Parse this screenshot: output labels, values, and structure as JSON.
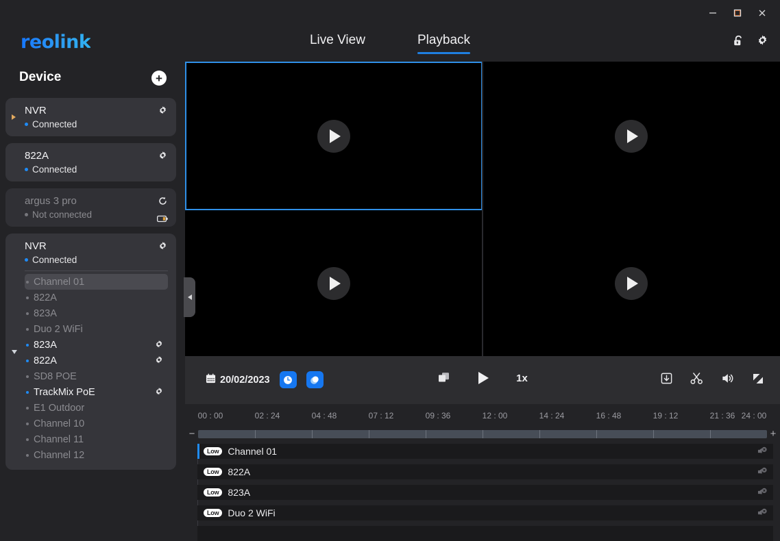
{
  "window": {
    "minimize": "minimize-icon",
    "maximize": "maximize-icon",
    "close": "close-icon"
  },
  "header": {
    "logo": "reolink",
    "tabs": [
      {
        "label": "Live View",
        "active": false
      },
      {
        "label": "Playback",
        "active": true
      }
    ],
    "icons": [
      {
        "name": "unlock-icon"
      },
      {
        "name": "gear-icon"
      }
    ],
    "accent_color": "#1f7fe0"
  },
  "sidebar": {
    "title": "Device",
    "add_label": "+",
    "devices": [
      {
        "name": "NVR",
        "status": "Connected",
        "connected": true,
        "expanded": false,
        "has_gear": true,
        "has_battery": false
      },
      {
        "name": "822A",
        "status": "Connected",
        "connected": true,
        "expanded": null,
        "has_gear": true,
        "has_battery": false
      },
      {
        "name": "argus 3 pro",
        "status": "Not connected",
        "connected": false,
        "expanded": null,
        "has_gear": false,
        "has_refresh": true,
        "has_battery": true
      },
      {
        "name": "NVR",
        "status": "Connected",
        "connected": true,
        "expanded": true,
        "has_gear": true,
        "has_battery": false,
        "channels": [
          {
            "label": "Channel 01",
            "online": false,
            "selected": true,
            "gear": false
          },
          {
            "label": "822A",
            "online": false,
            "selected": false,
            "gear": false
          },
          {
            "label": "823A",
            "online": false,
            "selected": false,
            "gear": false
          },
          {
            "label": "Duo 2 WiFi",
            "online": false,
            "selected": false,
            "gear": false
          },
          {
            "label": "823A",
            "online": true,
            "selected": false,
            "gear": true
          },
          {
            "label": "822A",
            "online": true,
            "selected": false,
            "gear": true
          },
          {
            "label": "SD8 POE",
            "online": false,
            "selected": false,
            "gear": false
          },
          {
            "label": "TrackMix PoE",
            "online": true,
            "selected": false,
            "gear": true
          },
          {
            "label": "E1 Outdoor",
            "online": false,
            "selected": false,
            "gear": false
          },
          {
            "label": "Channel 10",
            "online": false,
            "selected": false,
            "gear": false
          },
          {
            "label": "Channel 11",
            "online": false,
            "selected": false,
            "gear": false
          },
          {
            "label": "Channel 12",
            "online": false,
            "selected": false,
            "gear": false
          }
        ]
      }
    ]
  },
  "grid": {
    "cells": [
      {
        "id": "cell-1",
        "active": true,
        "play": "play-icon"
      },
      {
        "id": "cell-2",
        "active": false,
        "play": "play-icon"
      },
      {
        "id": "cell-3",
        "active": false,
        "play": "play-icon"
      },
      {
        "id": "cell-4",
        "active": false,
        "play": "play-icon"
      }
    ],
    "selection_color": "#2f90e8",
    "collapse_handle": "collapse-sidebar-handle"
  },
  "controls": {
    "date": "20/02/2023",
    "calendar_icon": "calendar-icon",
    "filter_buttons": [
      {
        "name": "clock-filter-icon"
      },
      {
        "name": "motion-filter-icon"
      }
    ],
    "layout_icon": "layout-icon",
    "play_icon": "play-icon",
    "speed": "1x",
    "right_icons": [
      {
        "name": "download-icon"
      },
      {
        "name": "scissors-icon"
      },
      {
        "name": "volume-icon"
      },
      {
        "name": "fullscreen-icon"
      }
    ],
    "blue_button_color": "#1677f0"
  },
  "timeline": {
    "ticks": [
      "00 : 00",
      "02 : 24",
      "04 : 48",
      "07 : 12",
      "09 : 36",
      "12 : 00",
      "14 : 24",
      "16 : 48",
      "19 : 12",
      "21 : 36",
      "24 : 00"
    ],
    "zoom_out": "−",
    "zoom_in": "+",
    "playhead_color": "#1f8bf5",
    "rows": [
      {
        "quality": "Low",
        "label": "Channel 01",
        "mute": "muted-speaker-icon",
        "playhead": true
      },
      {
        "quality": "Low",
        "label": "822A",
        "mute": "muted-speaker-icon",
        "playhead": false
      },
      {
        "quality": "Low",
        "label": "823A",
        "mute": "muted-speaker-icon",
        "playhead": false
      },
      {
        "quality": "Low",
        "label": "Duo 2 WiFi",
        "mute": "muted-speaker-icon",
        "playhead": false
      },
      {
        "quality": "",
        "label": "",
        "mute": "",
        "playhead": false
      }
    ]
  }
}
